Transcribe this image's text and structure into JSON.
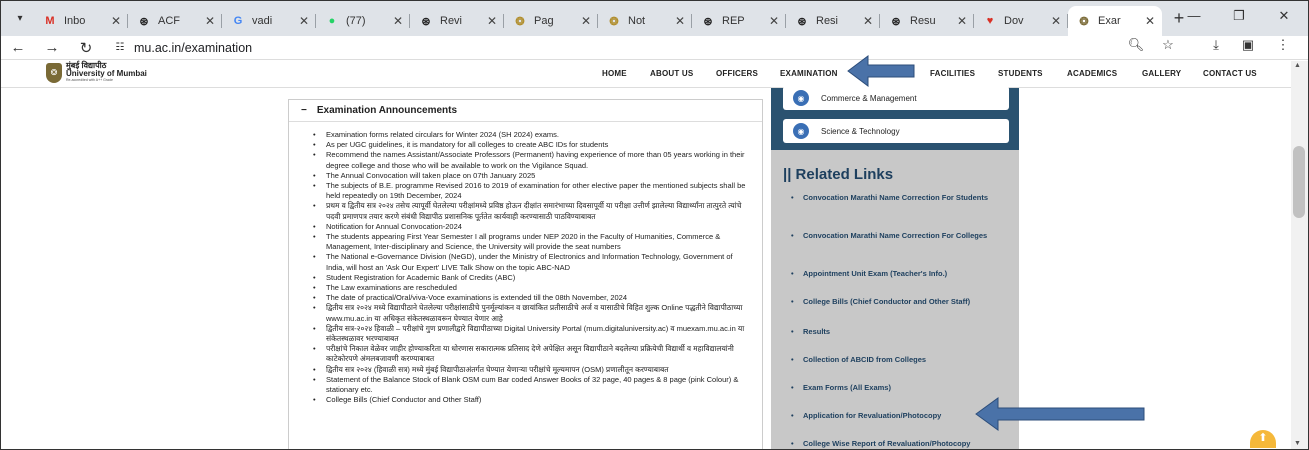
{
  "browser": {
    "tabs": [
      {
        "title": "Inbo",
        "icon": "gmail-icon",
        "glyph": "M",
        "color": "#d93025"
      },
      {
        "title": "ACF",
        "icon": "chatgpt-icon",
        "glyph": "⊛",
        "color": "#222222"
      },
      {
        "title": "vadi",
        "icon": "google-icon",
        "glyph": "G",
        "color": "#4285f4"
      },
      {
        "title": "(77)",
        "icon": "whatsapp-icon",
        "glyph": "●",
        "color": "#25d366"
      },
      {
        "title": "Revi",
        "icon": "chatgpt-icon",
        "glyph": "⊛",
        "color": "#222222"
      },
      {
        "title": "Pag",
        "icon": "university-crest-icon",
        "glyph": "❂",
        "color": "#b08d2a"
      },
      {
        "title": "Not",
        "icon": "university-crest-icon",
        "glyph": "❂",
        "color": "#b08d2a"
      },
      {
        "title": "REP",
        "icon": "chatgpt-icon",
        "glyph": "⊛",
        "color": "#222222"
      },
      {
        "title": "Resi",
        "icon": "chatgpt-icon",
        "glyph": "⊛",
        "color": "#222222"
      },
      {
        "title": "Resu",
        "icon": "chatgpt-icon",
        "glyph": "⊛",
        "color": "#222222"
      },
      {
        "title": "Dov",
        "icon": "heart-icon",
        "glyph": "♥",
        "color": "#d93025"
      },
      {
        "title": "Exar",
        "icon": "university-crest-icon",
        "glyph": "❂",
        "color": "#7a6a36",
        "active": true
      }
    ],
    "url": "mu.ac.in/examination"
  },
  "header": {
    "logo_name_marathi": "मुंबई विद्यापीठ",
    "logo_name_english": "University of Mumbai",
    "logo_tagline": "Re-accredited with A++ Grade",
    "nav": [
      "HOME",
      "ABOUT US",
      "OFFICERS",
      "EXAMINATION",
      "NS",
      "FACILITIES",
      "STUDENTS",
      "ACADEMICS",
      "GALLERY",
      "CONTACT US"
    ]
  },
  "announcements": {
    "heading": "Examination Announcements",
    "toggle": "−",
    "items": [
      "Examination forms related circulars for Winter 2024 (SH 2024) exams.",
      "As per UGC guidelines, it is mandatory for all colleges to create ABC IDs for students",
      "Recommend the names Assistant/Associate Professors (Permanent) having experience of more than 05 years working in their degree college and those who will be available to work on the Vigilance Squad.",
      "The Annual Convocation will taken place on 07th January 2025",
      "The subjects of B.E. programme Revised 2016 to 2019 of examination for other elective paper the mentioned subjects shall be held repeatedly on 19th December, 2024",
      "प्रथम व द्वितीय सत्र २०२४ तसेच त्यापूर्वी घेतलेल्या परीक्षांमध्ये प्रविष्ठ होऊन दीक्षांत समारंभाच्या दिवसापूर्वी या परीक्षा उत्तीर्ण झालेल्या विद्यार्थ्यांना तात्पुरते त्यांचे पदवी प्रमाणपत्र तयार करणे संबंधी विद्यापीठ प्रशासनिक पूर्ततेत कार्यवाही करण्यासाठी पाठविण्याबाबत",
      "Notification for Annual Convocation-2024",
      "The students appearing First Year Semester I all programs under NEP 2020 in the Faculty of Humanities, Commerce & Management, Inter-disciplinary and Science, the University will provide the seat numbers",
      "The National e-Governance Division (NeGD), under the Ministry of Electronics and Information Technology, Government of India, will host an 'Ask Our Expert' LIVE Talk Show on the topic ABC-NAD",
      "Student Registration for Academic Bank of Credits (ABC)",
      "The Law examinations are rescheduled",
      "The date of practical/Oral/viva-Voce examinations is extended till the 08th November, 2024",
      "द्वितीय सत्र २०२४ मध्ये विद्यापीठाने घेतलेल्या परीक्षांसाठीचे पुनर्मूल्यांकन व छायांकित प्रतीसाठीचे अर्ज व यासाठीचे विहित शुल्क Online पद्धतीने विद्यापीठाच्या www.mu.ac.in या अधिकृत संकेतस्थळावरून घेण्यात येणार आहे",
      "द्वितीय सत्र-२०२४ हिवाळी – परीक्षांचे गुण प्रणालीद्वारे विद्यापीठाच्या Digital University Portal (mum.digitaluniversity.ac) व muexam.mu.ac.in या संकेतस्थळावर भरण्याबाबत",
      "परीक्षांचे निकाल वेळेवर जाहीर होण्याकरिता या धोरणास सकारात्मक प्रतिसाद देणे अपेक्षित असून विद्यापीठाने बदलेल्या प्रक्रियेची विद्यार्थी व महाविद्यालयांनी काटेकोरपणे अंमलबजावणी करण्याबाबत",
      "द्वितीय सत्र २०२४ (हिवाळी सत्र) मध्ये मुंबई विद्यापीठाअंतर्गत घेण्यात येणाऱ्या परीक्षांचे मूल्यमापन (OSM) प्रणालीतून करण्याबाबत",
      "Statement of the Balance Stock of Blank OSM cum Bar coded Answer Books of 32 page, 40 pages & 8 page (pink Colour) & stationary etc.",
      "College Bills (Chief Conductor and Other Staff)"
    ]
  },
  "sidebar": {
    "faculty_buttons": [
      "Commerce & Management",
      "Science & Technology"
    ],
    "related_title": "|| Related Links",
    "links": [
      "Convocation Marathi Name Correction For Students",
      "Convocation Marathi Name Correction For Colleges",
      "Appointment Unit Exam (Teacher's Info.)",
      "College Bills (Chief Conductor and Other Staff)",
      "Results",
      "Collection of ABCID from Colleges",
      "Exam Forms (All Exams)",
      "Application for Revaluation/Photocopy",
      "College Wise Report of Revaluation/Photocopy"
    ]
  },
  "colors": {
    "arrow": "#4a72a8",
    "sidebar_dark": "#2a5270",
    "sidebar_bg": "#c8c8c8",
    "link_text": "#1d3f5e",
    "scroll_to_top": "#f5b83a"
  }
}
